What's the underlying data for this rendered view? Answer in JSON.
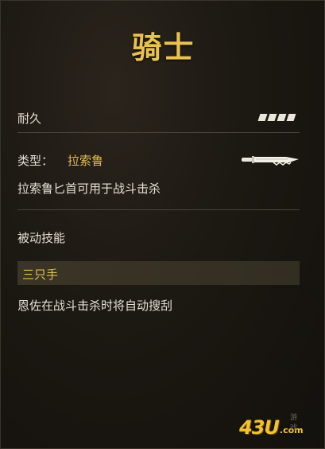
{
  "item": {
    "title": "骑士",
    "durability_label": "耐久",
    "durability_pips": 4,
    "type_key": "类型：",
    "type_value": "拉索鲁",
    "weapon_icon": "knife-icon",
    "description": "拉索鲁匕首可用于战斗击杀"
  },
  "passive": {
    "label": "被动技能",
    "skill_name": "三只手",
    "skill_desc": "恩佐在战斗击杀时将自动搜刮"
  },
  "watermark": {
    "main": "43U",
    "suffix": ".com",
    "tag": "游戏"
  },
  "colors": {
    "gold": "#ecc24f",
    "accent": "#e2bd52",
    "text": "#e6e0d3",
    "background": "#1c1812"
  }
}
